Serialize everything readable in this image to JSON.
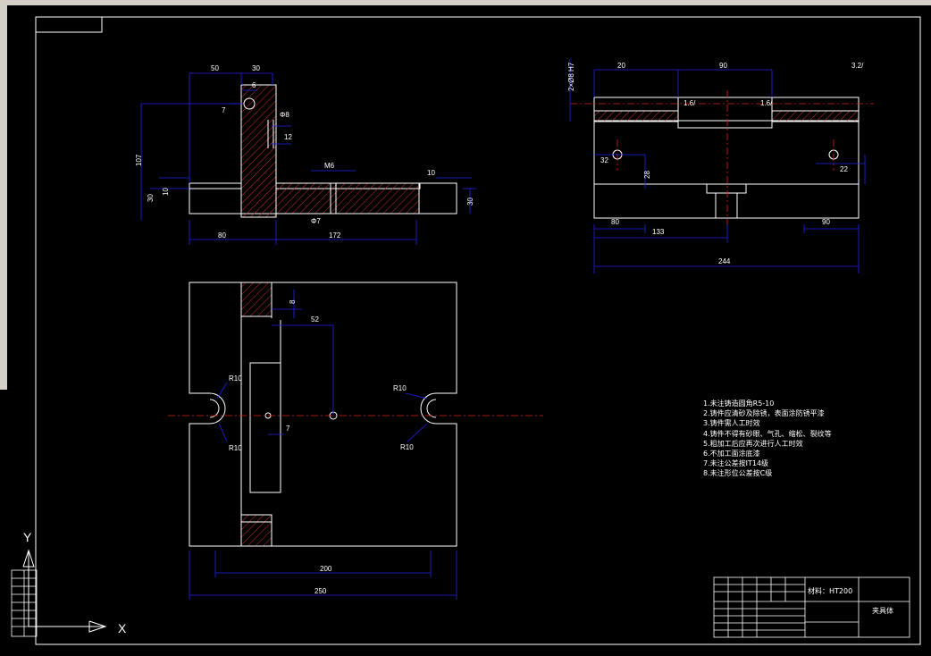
{
  "app": {
    "background": "#000000",
    "colors": {
      "outline": "#ffffff",
      "dimension": "#2222ee",
      "centerline": "#dd2222",
      "hatch": "#cc3333",
      "text": "#ffffff"
    }
  },
  "drawing": {
    "front_view_dims": {
      "d50": "50",
      "d30": "30",
      "d6": "6",
      "d7": "7",
      "d40": "Φ8",
      "d12": "12",
      "d107": "107",
      "d30b": "30",
      "d10": "10",
      "d80": "80",
      "d172": "172",
      "d10b": "10",
      "d30c": "30",
      "dM6": "M6",
      "dphi": "Φ7"
    },
    "side_view_dims": {
      "d20": "20",
      "d90": "90",
      "d32": "32",
      "d80": "80",
      "d22": "22",
      "d28": "28",
      "d133": "133",
      "d90b": "90",
      "d244": "244",
      "r1": "1.6/",
      "r2": "1.6/",
      "rough": "3.2/",
      "side": "2×Ø8 H7"
    },
    "plan_view_dims": {
      "d52": "52",
      "d7": "7",
      "r10a": "R10",
      "r10b": "R10",
      "r10c": "R10",
      "r10d": "R10",
      "d200": "200",
      "d250": "250",
      "dtop": "8"
    },
    "ucs": {
      "x": "X",
      "y": "Y"
    }
  },
  "notes": {
    "items": [
      "1.未注铸造圆角R5-10",
      "2.铸件应清砂及除锈，表面涂防锈平漆",
      "3.铸件需人工时效",
      "4.铸件不得有砂眼、气孔、缩松、裂纹等",
      "5.粗加工后应再次进行人工时效",
      "6.不加工面涂底漆",
      "7.未注公差按IT14级",
      "8.未注形位公差按C级"
    ]
  },
  "title_block": {
    "material": "材料：HT200",
    "title": "夹具体"
  }
}
